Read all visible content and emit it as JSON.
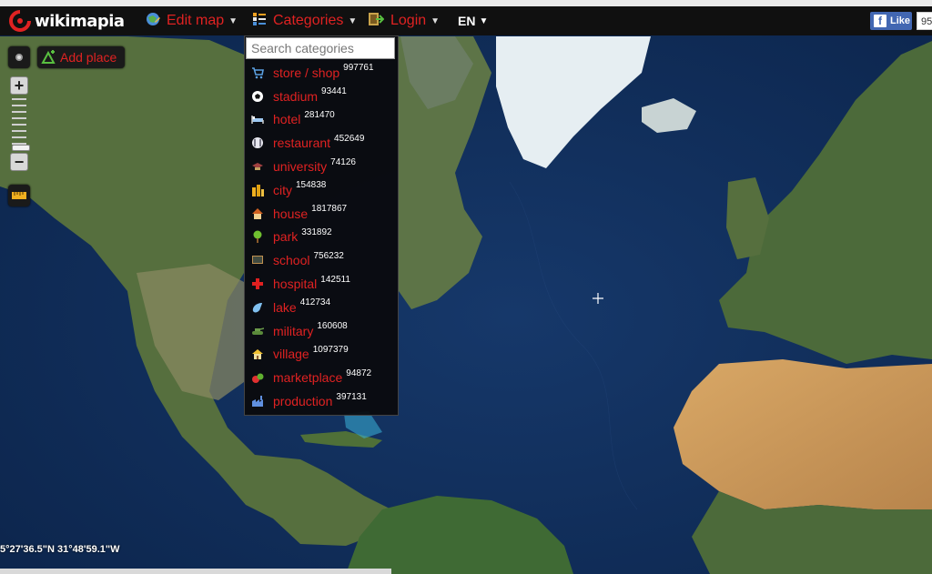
{
  "header": {
    "brand": "wikimapia",
    "menu": [
      {
        "label": "Edit map",
        "icon": "edit-map-icon"
      },
      {
        "label": "Categories",
        "icon": "categories-icon"
      },
      {
        "label": "Login",
        "icon": "login-icon"
      }
    ],
    "language": "EN",
    "facebook": {
      "like_label": "Like",
      "count": "95"
    }
  },
  "map_controls": {
    "add_place_label": "Add place",
    "zoom_in": "+",
    "zoom_out": "−"
  },
  "categories": {
    "search_placeholder": "Search categories",
    "items": [
      {
        "label": "store / shop",
        "count": "997761",
        "icon": "cart-icon"
      },
      {
        "label": "stadium",
        "count": "93441",
        "icon": "soccer-ball-icon"
      },
      {
        "label": "hotel",
        "count": "281470",
        "icon": "bed-icon"
      },
      {
        "label": "restaurant",
        "count": "452649",
        "icon": "plate-icon"
      },
      {
        "label": "university",
        "count": "74126",
        "icon": "graduation-cap-icon"
      },
      {
        "label": "city",
        "count": "154838",
        "icon": "buildings-icon"
      },
      {
        "label": "house",
        "count": "1817867",
        "icon": "house-icon"
      },
      {
        "label": "park",
        "count": "331892",
        "icon": "tree-icon"
      },
      {
        "label": "school",
        "count": "756232",
        "icon": "blackboard-icon"
      },
      {
        "label": "hospital",
        "count": "142511",
        "icon": "red-cross-icon"
      },
      {
        "label": "lake",
        "count": "412734",
        "icon": "lake-drop-icon"
      },
      {
        "label": "military",
        "count": "160608",
        "icon": "tank-icon"
      },
      {
        "label": "village",
        "count": "1097379",
        "icon": "village-hut-icon"
      },
      {
        "label": "marketplace",
        "count": "94872",
        "icon": "fruit-icon"
      },
      {
        "label": "production",
        "count": "397131",
        "icon": "factory-icon"
      }
    ]
  },
  "status": {
    "coordinates": "5°27'36.5\"N 31°48'59.1\"W"
  },
  "colors": {
    "accent": "#e02222",
    "bar": "#101010",
    "ocean": "#0d2850",
    "land": "#4a6a3a",
    "desert": "#c89858",
    "ice": "#e6eef2"
  }
}
